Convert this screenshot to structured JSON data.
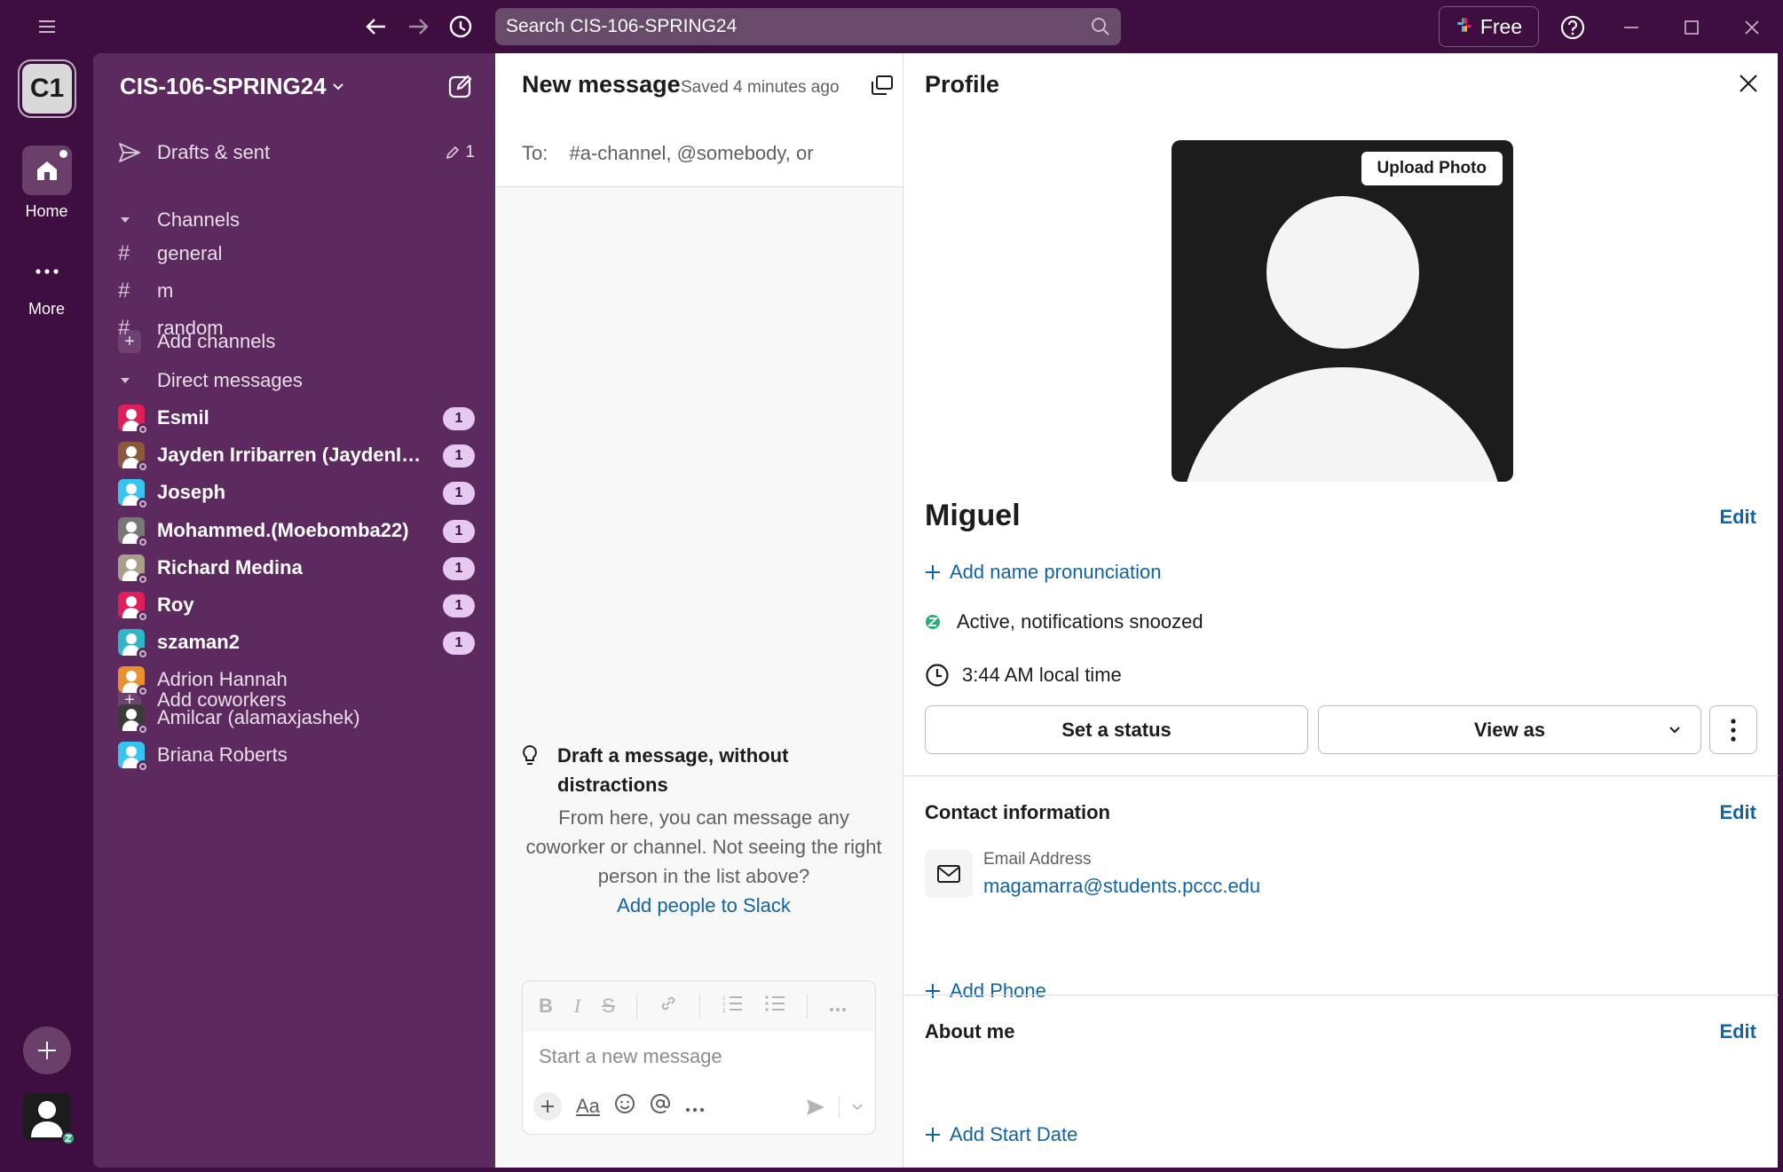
{
  "titlebar": {
    "search_placeholder": "Search CIS-106-SPRING24",
    "free_label": "Free"
  },
  "rail": {
    "workspace_initials": "C1",
    "home_label": "Home",
    "more_label": "More"
  },
  "sidebar": {
    "workspace_name": "CIS-106-SPRING24",
    "drafts_label": "Drafts & sent",
    "drafts_count": "1",
    "channels_header": "Channels",
    "channels": [
      {
        "name": "general"
      },
      {
        "name": "m"
      },
      {
        "name": "random"
      }
    ],
    "add_channels": "Add channels",
    "dm_header": "Direct messages",
    "dms": [
      {
        "name": "Esmil",
        "badge": "1",
        "bold": true,
        "color": "#e01e5a"
      },
      {
        "name": "Jayden Irribarren (JaydenIrribarren)",
        "badge": "1",
        "bold": true,
        "color": "#8b5a3c"
      },
      {
        "name": "Joseph",
        "badge": "1",
        "bold": true,
        "color": "#36c5f0"
      },
      {
        "name": "Mohammed.(Moebomba22)",
        "badge": "1",
        "bold": true,
        "color": "#777777"
      },
      {
        "name": "Richard Medina",
        "badge": "1",
        "bold": true,
        "color": "#a9a089"
      },
      {
        "name": "Roy",
        "badge": "1",
        "bold": true,
        "color": "#e01e5a"
      },
      {
        "name": "szaman2",
        "badge": "1",
        "bold": true,
        "color": "#2eb6c9"
      },
      {
        "name": "Adrion Hannah",
        "badge": "",
        "bold": false,
        "color": "#e8912d"
      },
      {
        "name": "Amilcar (alamaxjashek)",
        "badge": "",
        "bold": false,
        "color": "#3a3a3a"
      },
      {
        "name": "Briana Roberts",
        "badge": "",
        "bold": false,
        "color": "#36c5f0"
      }
    ],
    "add_coworkers": "Add coworkers"
  },
  "message": {
    "title": "New message",
    "saved": "Saved 4 minutes ago",
    "to_label": "To:",
    "to_placeholder": "#a-channel, @somebody, or",
    "tip_title": "Draft a message, without distractions",
    "tip_body": "From here, you can message any coworker or channel. Not seeing the right person in the list above?",
    "tip_link": "Add people to Slack",
    "composer_placeholder": "Start a new message"
  },
  "profile": {
    "title": "Profile",
    "upload_photo": "Upload Photo",
    "name": "Miguel",
    "edit": "Edit",
    "add_pronunciation": "Add name pronunciation",
    "status": "Active, notifications snoozed",
    "local_time": "3:44 AM local time",
    "set_status": "Set a status",
    "view_as": "View as",
    "contact_title": "Contact information",
    "email_label": "Email Address",
    "email_value": "magamarra@students.pccc.edu",
    "add_phone": "Add Phone",
    "about_title": "About me",
    "add_start_date": "Add Start Date"
  },
  "colors": {
    "aubergine": "#3f0e40",
    "sidebar": "#5c2a5e",
    "link": "#1264a3"
  }
}
